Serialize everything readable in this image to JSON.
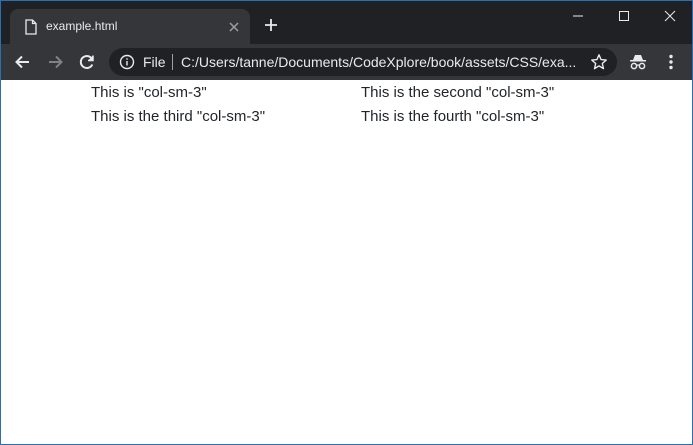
{
  "browser": {
    "tab_title": "example.html",
    "scheme_label": "File",
    "url": "C:/Users/tanne/Documents/CodeXplore/book/assets/CSS/exa..."
  },
  "icons": {
    "tab_page": "document-icon",
    "tab_close": "close-icon",
    "new_tab": "plus-icon",
    "minimize": "minimize-icon",
    "maximize": "maximize-icon",
    "close_window": "close-icon",
    "back": "arrow-left-icon",
    "forward": "arrow-right-icon",
    "reload": "reload-icon",
    "site_info": "info-icon",
    "bookmark": "star-icon",
    "incognito": "incognito-icon",
    "menu": "kebab-menu-icon"
  },
  "colors": {
    "titlebar": "#202124",
    "toolbar": "#35363a",
    "omnibox": "#202124",
    "text_light": "#e8eaed",
    "page_text": "#212529"
  },
  "content": {
    "rows": [
      [
        "This is \"col-sm-3\"",
        "This is the second \"col-sm-3\""
      ],
      [
        "This is the third \"col-sm-3\"",
        "This is the fourth \"col-sm-3\""
      ]
    ]
  }
}
